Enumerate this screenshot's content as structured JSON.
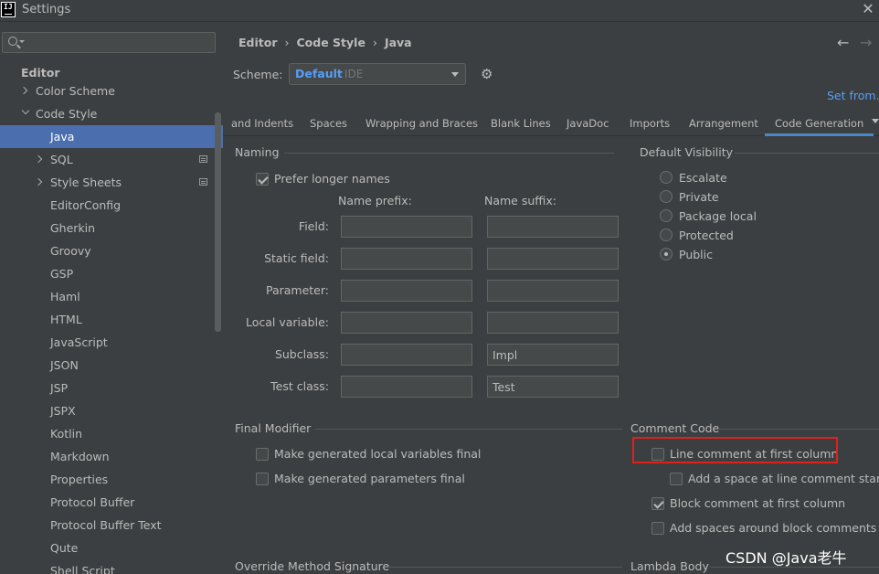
{
  "window": {
    "title": "Settings",
    "logo_text": "IJ"
  },
  "sidebar": {
    "search_placeholder": "",
    "items": [
      {
        "label": "Editor"
      },
      {
        "label": "Color Scheme"
      },
      {
        "label": "Code Style"
      },
      {
        "label": "Java"
      },
      {
        "label": "SQL"
      },
      {
        "label": "Style Sheets"
      },
      {
        "label": "EditorConfig"
      },
      {
        "label": "Gherkin"
      },
      {
        "label": "Groovy"
      },
      {
        "label": "GSP"
      },
      {
        "label": "Haml"
      },
      {
        "label": "HTML"
      },
      {
        "label": "JavaScript"
      },
      {
        "label": "JSON"
      },
      {
        "label": "JSP"
      },
      {
        "label": "JSPX"
      },
      {
        "label": "Kotlin"
      },
      {
        "label": "Markdown"
      },
      {
        "label": "Properties"
      },
      {
        "label": "Protocol Buffer"
      },
      {
        "label": "Protocol Buffer Text"
      },
      {
        "label": "Qute"
      },
      {
        "label": "Shell Script"
      }
    ]
  },
  "header": {
    "breadcrumb": [
      "Editor",
      "Code Style",
      "Java"
    ],
    "breadcrumb_sep": "›",
    "back_arrow": "←",
    "forward_arrow": "→",
    "scheme_label": "Scheme:",
    "scheme_value": "Default",
    "scheme_sub": "IDE",
    "set_from": "Set from..."
  },
  "tabs": [
    "and Indents",
    "Spaces",
    "Wrapping and Braces",
    "Blank Lines",
    "JavaDoc",
    "Imports",
    "Arrangement",
    "Code Generation"
  ],
  "active_tab": "Code Generation",
  "naming": {
    "title": "Naming",
    "prefer_longer": {
      "label": "Prefer longer names",
      "checked": true
    },
    "prefix_header": "Name prefix:",
    "suffix_header": "Name suffix:",
    "rows": [
      {
        "label": "Field:",
        "prefix": "",
        "suffix": ""
      },
      {
        "label": "Static field:",
        "prefix": "",
        "suffix": ""
      },
      {
        "label": "Parameter:",
        "prefix": "",
        "suffix": ""
      },
      {
        "label": "Local variable:",
        "prefix": "",
        "suffix": ""
      },
      {
        "label": "Subclass:",
        "prefix": "",
        "suffix": "Impl"
      },
      {
        "label": "Test class:",
        "prefix": "",
        "suffix": "Test"
      }
    ]
  },
  "visibility": {
    "title": "Default Visibility",
    "options": [
      "Escalate",
      "Private",
      "Package local",
      "Protected",
      "Public"
    ],
    "selected": "Public"
  },
  "final_modifier": {
    "title": "Final Modifier",
    "local_vars": {
      "label": "Make generated local variables final",
      "checked": false
    },
    "params": {
      "label": "Make generated parameters final",
      "checked": false
    }
  },
  "comment_code": {
    "title": "Comment Code",
    "line_first_col": {
      "label": "Line comment at first column",
      "checked": false
    },
    "add_space": {
      "label": "Add a space at line comment start",
      "checked": false
    },
    "block_first_col": {
      "label": "Block comment at first column",
      "checked": true
    },
    "add_spaces_block": {
      "label": "Add spaces around block comments",
      "checked": false
    }
  },
  "override": {
    "title": "Override Method Signature"
  },
  "lambda": {
    "title": "Lambda Body"
  },
  "watermark": "CSDN @Java老牛",
  "colors": {
    "background": "#3c3f41",
    "selection": "#4b6eaf",
    "link": "#589df6",
    "highlight": "#e0211a"
  }
}
